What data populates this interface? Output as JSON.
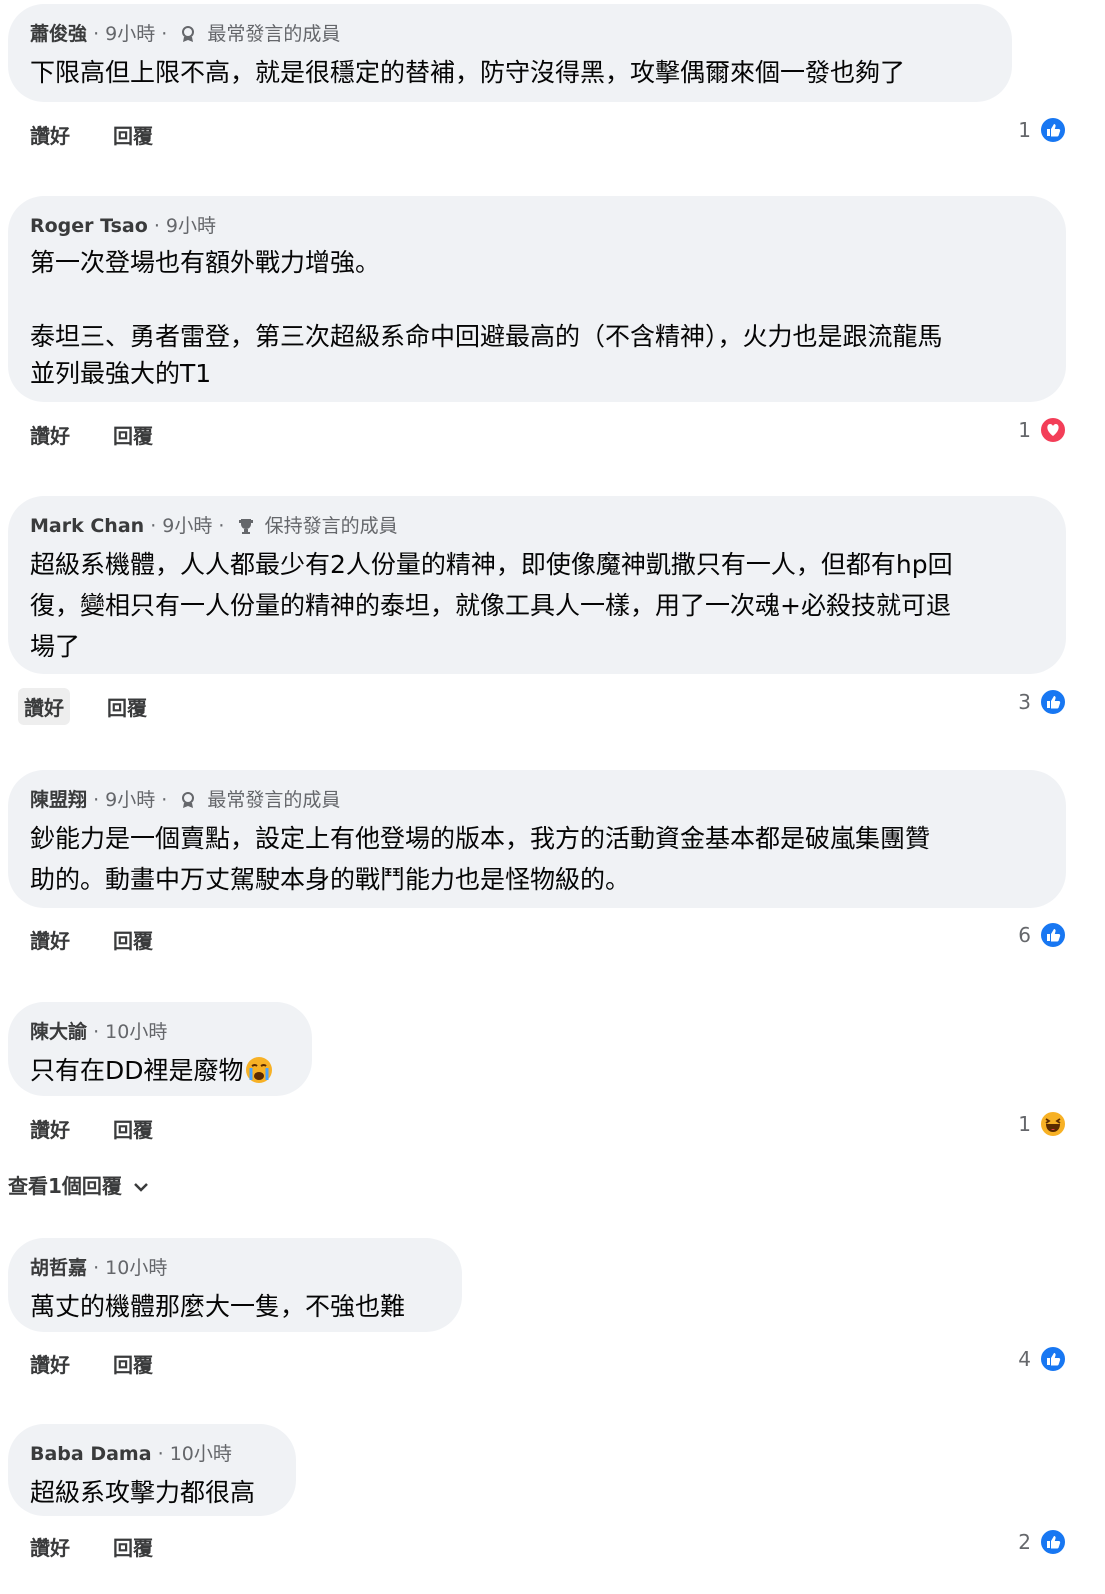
{
  "actions": {
    "like": "讚好",
    "reply": "回覆"
  },
  "comments": [
    {
      "author": "蕭俊強",
      "time": "· 9小時 ·",
      "badge": "最常發言的成員",
      "badge_icon": "member-icon",
      "text": "下限高但上限不高，就是很穩定的替補，防守沒得黑，攻擊偶爾來個一發也夠了",
      "reaction_count": "1",
      "reaction": "like-icon"
    },
    {
      "author": "Roger Tsao",
      "time": "· 9小時",
      "badge": "",
      "text": "第一次登場也有額外戰力增強。\n\n泰坦三、勇者雷登，第三次超級系命中回避最高的（不含精神），火力也是跟流龍馬\n並列最強大的T1",
      "reaction_count": "1",
      "reaction": "love-icon"
    },
    {
      "author": "Mark Chan",
      "time": "· 9小時 ·",
      "badge": "保持發言的成員",
      "badge_icon": "trophy-icon",
      "text": "超級系機體，人人都最少有2人份量的精神，即使像魔神凱撒只有一人，但都有hp回\n復，變相只有一人份量的精神的泰坦，就像工具人一樣，用了一次魂+必殺技就可退\n場了",
      "reaction_count": "3",
      "reaction": "like-icon"
    },
    {
      "author": "陳盟翔",
      "time": "· 9小時 ·",
      "badge": "最常發言的成員",
      "badge_icon": "member-icon",
      "text": "鈔能力是一個賣點，設定上有他登場的版本，我方的活動資金基本都是破嵐集團贊\n助的。動畫中万丈駕駛本身的戰鬥能力也是怪物級的。",
      "reaction_count": "6",
      "reaction": "like-icon"
    },
    {
      "author": "陳大諭",
      "time": "· 10小時",
      "badge": "",
      "text": "只有在DD裡是廢物",
      "reaction_count": "1",
      "reaction": "haha-icon"
    },
    {
      "author": "胡哲嘉",
      "time": "· 10小時",
      "badge": "",
      "text": "萬丈的機體那麼大一隻，不強也難",
      "reaction_count": "4",
      "reaction": "like-icon"
    },
    {
      "author": "Baba Dama",
      "time": "· 10小時",
      "badge": "",
      "text": "超級系攻擊力都很高",
      "reaction_count": "2",
      "reaction": "like-icon"
    }
  ],
  "view_replies": "查看1個回覆",
  "colors": {
    "bubble": "#f0f2f5",
    "like": "#1877f2",
    "love": "#f33e58",
    "haha": "#f7b125"
  }
}
